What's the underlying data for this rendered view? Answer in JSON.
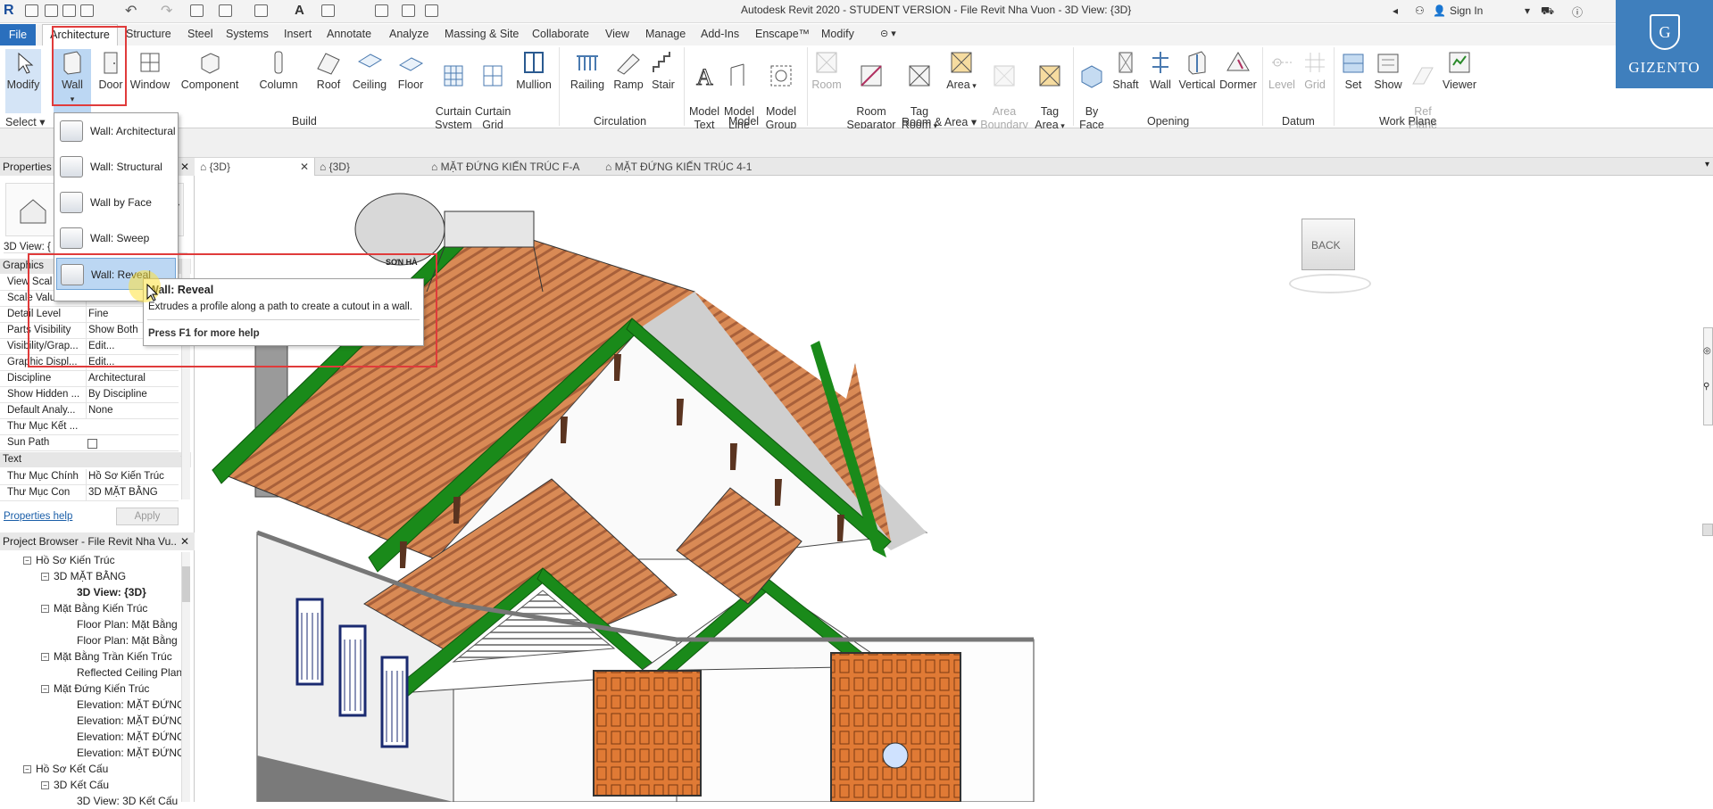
{
  "window": {
    "title": "Autodesk Revit 2020 - STUDENT VERSION - File Revit Nha Vuon - 3D View: {3D}",
    "sign_in": "Sign In",
    "app_logo": "R"
  },
  "menu": {
    "file": "File",
    "tabs": [
      "Architecture",
      "Structure",
      "Steel",
      "Systems",
      "Insert",
      "Annotate",
      "Analyze",
      "Massing & Site",
      "Collaborate",
      "View",
      "Manage",
      "Add-Ins",
      "Enscape™",
      "Modify"
    ]
  },
  "ribbon": {
    "select": "Select",
    "modify": "Modify",
    "tools": {
      "wall": "Wall",
      "door": "Door",
      "window": "Window",
      "component": "Component",
      "column": "Column",
      "roof": "Roof",
      "ceiling": "Ceiling",
      "floor": "Floor",
      "curtain_system": "Curtain\nSystem",
      "curtain_grid": "Curtain\nGrid",
      "mullion": "Mullion",
      "railing": "Railing",
      "ramp": "Ramp",
      "stair": "Stair",
      "model_text": "Model\nText",
      "model_line": "Model\nLine",
      "model_group": "Model\nGroup",
      "room": "Room",
      "room_separator": "Room\nSeparator",
      "tag_room": "Tag\nRoom",
      "area": "Area",
      "area_boundary": "Area\nBoundary",
      "tag_area": "Tag\nArea",
      "by_face": "By\nFace",
      "shaft": "Shaft",
      "wall_opening": "Wall",
      "vertical": "Vertical",
      "dormer": "Dormer",
      "level": "Level",
      "grid": "Grid",
      "set": "Set",
      "show": "Show",
      "ref_plane": "Ref\nPlane",
      "viewer": "Viewer"
    },
    "panels": {
      "build": "Build",
      "circulation": "Circulation",
      "model": "Model",
      "room_area": "Room & Area",
      "opening": "Opening",
      "datum": "Datum",
      "work_plane": "Work Plane"
    }
  },
  "brand": {
    "letter": "G",
    "name": "GIZENTO"
  },
  "view_tabs": [
    "{3D}",
    "{3D}",
    "MẶT ĐỨNG KIẾN TRÚC F-A",
    "MẶT ĐỨNG KIẾN TRÚC 4-1"
  ],
  "properties": {
    "title": "Properties",
    "type_selector": "3D View: {",
    "group_graphics": "Graphics",
    "rows": [
      {
        "k": "View Scal",
        "v": ""
      },
      {
        "k": "Scale Value",
        "v": "1:"
      },
      {
        "k": "Detail Level",
        "v": "Fine"
      },
      {
        "k": "Parts Visibility",
        "v": "Show Both"
      },
      {
        "k": "Visibility/Grap...",
        "v": "Edit..."
      },
      {
        "k": "Graphic Displ...",
        "v": "Edit..."
      },
      {
        "k": "Discipline",
        "v": "Architectural"
      },
      {
        "k": "Show Hidden ...",
        "v": "By Discipline"
      },
      {
        "k": "Default Analy...",
        "v": "None"
      },
      {
        "k": "Thư Mục Kết ...",
        "v": ""
      },
      {
        "k": "Sun Path",
        "v": ""
      }
    ],
    "group_text": "Text",
    "text_rows": [
      {
        "k": "Thư Mục Chính",
        "v": "Hồ Sơ Kiến Trúc"
      },
      {
        "k": "Thư Mục Con",
        "v": "3D MẶT BẰNG"
      }
    ],
    "help_link": "Properties help",
    "apply": "Apply"
  },
  "project_browser": {
    "title": "Project Browser - File Revit Nha Vu...",
    "nodes": [
      {
        "t": "Hồ Sơ Kiến Trúc",
        "lvl": 1,
        "toggle": "−"
      },
      {
        "t": "3D MẶT BẰNG",
        "lvl": 2,
        "toggle": "−"
      },
      {
        "t": "3D View: {3D}",
        "lvl": 3,
        "toggle": "",
        "bold": true
      },
      {
        "t": "Mặt Bằng Kiến Trúc",
        "lvl": 2,
        "toggle": "−"
      },
      {
        "t": "Floor Plan: Mặt Bằng",
        "lvl": 3,
        "toggle": ""
      },
      {
        "t": "Floor Plan: Mặt Bằng",
        "lvl": 3,
        "toggle": ""
      },
      {
        "t": "Mặt Bằng Trần Kiến Trúc",
        "lvl": 2,
        "toggle": "−"
      },
      {
        "t": "Reflected Ceiling Plan",
        "lvl": 3,
        "toggle": ""
      },
      {
        "t": "Mặt Đứng Kiến Trúc",
        "lvl": 2,
        "toggle": "−"
      },
      {
        "t": "Elevation: MẶT ĐỨNG",
        "lvl": 3,
        "toggle": ""
      },
      {
        "t": "Elevation: MẶT ĐỨNG",
        "lvl": 3,
        "toggle": ""
      },
      {
        "t": "Elevation: MẶT ĐỨNG",
        "lvl": 3,
        "toggle": ""
      },
      {
        "t": "Elevation: MẶT ĐỨNG",
        "lvl": 3,
        "toggle": ""
      },
      {
        "t": "Hồ Sơ Kết Cấu",
        "lvl": 1,
        "toggle": "−"
      },
      {
        "t": "3D Kết Cấu",
        "lvl": 2,
        "toggle": "−"
      },
      {
        "t": "3D View: 3D Kết Cấu",
        "lvl": 3,
        "toggle": ""
      }
    ]
  },
  "wall_dropdown": [
    {
      "label": "Wall: Architectural"
    },
    {
      "label": "Wall: Structural"
    },
    {
      "label": "Wall by Face"
    },
    {
      "label": "Wall: Sweep"
    },
    {
      "label": "Wall: Reveal"
    }
  ],
  "tooltip": {
    "title": "Wall: Reveal",
    "description": "Extrudes a profile along a path to create a cutout in a wall.",
    "footer": "Press F1 for more help"
  },
  "viewcube": {
    "face": "BACK"
  },
  "model": {
    "tank_label": "SƠN HÀ"
  },
  "colors": {
    "accent": "#2a6fbd",
    "roof_trim": "#1a8a1a",
    "roof_tile": "#d98a55",
    "door": "#e07a35",
    "highlight": "#e03b3b",
    "brand": "#3f7fbd"
  }
}
